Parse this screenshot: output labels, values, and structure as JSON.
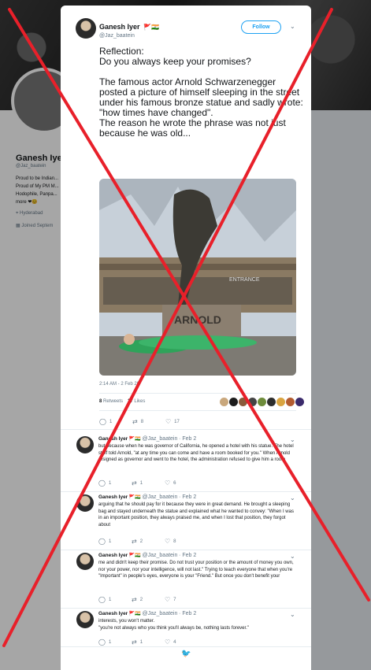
{
  "background": {
    "name": "Ganesh Iye",
    "handle": "@Jaz_baatein",
    "bio": "Proud to be Indian... Proud of My PM M... Hodophile, Panpa... more ❤😊",
    "location": "Hyderabad",
    "joined": "Joined Septem"
  },
  "tweet": {
    "author": {
      "name": "Ganesh Iyer",
      "flags": "🚩🇮🇳",
      "handle": "@Jaz_baatein"
    },
    "follow_label": "Follow",
    "text": "Reflection:\nDo you always keep your promises?\n\nThe famous actor Arnold Schwarzenegger posted a picture of himself sleeping in the street under his famous bronze statue and sadly wrote: \"how times have changed\".\nThe reason he wrote the phrase was not just because he was old...",
    "photo": {
      "sign_entrance": "ENTRANCE",
      "sign_name": "ARNOLD"
    },
    "timestamp": "2:14 AM - 2 Feb 20",
    "retweets": {
      "count": "8",
      "label": "Retweets"
    },
    "likes": {
      "count": "17",
      "label": "Likes"
    },
    "actions": {
      "replies": "1",
      "retweets": "8",
      "likes": "17"
    }
  },
  "replies": [
    {
      "name": "Ganesh Iyer",
      "flags": "🚩🇮🇳",
      "handle": "@Jaz_baatein",
      "date": "· Feb 2",
      "text": "but because when he was governor of California, he opened a hotel with his statue. The hotel staff told Arnold, \"at any time you can come and have a room booked for you.\" When Arnold resigned as governor and went to the hotel, the administration refused to give him a room",
      "replies": "1",
      "retweets": "1",
      "likes": "6"
    },
    {
      "name": "Ganesh Iyer",
      "flags": "🚩🇮🇳",
      "handle": "@Jaz_baatein",
      "date": "· Feb 2",
      "text": "arguing that he should pay for it because they were in great demand. He brought a sleeping bag and stayed underneath the statue and explained what he wanted to convey: \"When I was in an important position, they always praised me, and when I lost that position, they forgot about",
      "replies": "1",
      "retweets": "2",
      "likes": "8"
    },
    {
      "name": "Ganesh Iyer",
      "flags": "🚩🇮🇳",
      "handle": "@Jaz_baatein",
      "date": "· Feb 2",
      "text": "me and didn't keep their promise. Do not trust your position or the amount of money you own, nor your power, nor your intelligence, will not last.\" Trying to teach everyone that when you're \"Important\" in people's eyes, everyone is your \"Friend.\" But once you don't benefit your",
      "replies": "1",
      "retweets": "2",
      "likes": "7"
    },
    {
      "name": "Ganesh Iyer",
      "flags": "🚩🇮🇳",
      "handle": "@Jaz_baatein",
      "date": "· Feb 2",
      "text": "interests, you won't matter.\n\"you're not always who you think you'll always be, nothing lasts forever.\"",
      "replies": "1",
      "retweets": "1",
      "likes": "4"
    }
  ],
  "colors": {
    "accent": "#1da1f2",
    "like_red": "#e0245e",
    "xmark": "#e8202a"
  },
  "icons": {
    "reply": "speech-bubble-icon",
    "retweet": "retweet-arrows-icon",
    "like": "heart-icon",
    "more": "chevron-down-icon",
    "logo": "twitter-bird-icon"
  }
}
